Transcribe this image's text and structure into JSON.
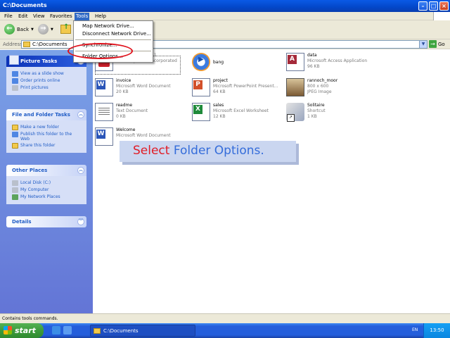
{
  "window": {
    "title": "C:\\Documents"
  },
  "menubar": {
    "items": [
      "File",
      "Edit",
      "View",
      "Favorites",
      "Tools",
      "Help"
    ],
    "active": "Tools"
  },
  "toolbar": {
    "back_label": "Back"
  },
  "address": {
    "label": "Address",
    "value": "C:\\Documents",
    "go_label": "Go"
  },
  "tools_menu": {
    "items": [
      "Map Network Drive...",
      "Disconnect Network Drive...",
      "Synchronize...",
      "Folder Options..."
    ]
  },
  "left_pane": {
    "picture_tasks": {
      "title": "Picture Tasks",
      "items": [
        "View as a slide show",
        "Order prints online",
        "Print pictures"
      ]
    },
    "file_folder_tasks": {
      "title": "File and Folder Tasks",
      "items": [
        "Make a new folder",
        "Publish this folder to the Web",
        "Share this folder"
      ]
    },
    "other_places": {
      "title": "Other Places",
      "items": [
        "Local Disk (C:)",
        "My Computer",
        "My Network Places"
      ]
    },
    "details": {
      "title": "Details"
    }
  },
  "files": [
    {
      "name": "",
      "type": "Acrobat Reader 3.1",
      "info": "Adobe Systems Incorporated",
      "icon": "pdf-icon"
    },
    {
      "name": "bang",
      "type": "",
      "info": "",
      "icon": "media-icon"
    },
    {
      "name": "data",
      "type": "Microsoft Access Application",
      "info": "96 KB",
      "icon": "access-icon"
    },
    {
      "name": "invoice",
      "type": "Microsoft Word Document",
      "info": "20 KB",
      "icon": "word-icon"
    },
    {
      "name": "project",
      "type": "Microsoft PowerPoint Present...",
      "info": "64 KB",
      "icon": "powerpoint-icon"
    },
    {
      "name": "rannoch_moor",
      "type": "800 x 600",
      "info": "JPEG Image",
      "icon": "image-icon"
    },
    {
      "name": "readme",
      "type": "Text Document",
      "info": "0 KB",
      "icon": "text-icon"
    },
    {
      "name": "sales",
      "type": "Microsoft Excel Worksheet",
      "info": "12 KB",
      "icon": "excel-icon"
    },
    {
      "name": "Solitaire",
      "type": "Shortcut",
      "info": "1 KB",
      "icon": "shortcut-icon"
    },
    {
      "name": "Welcome",
      "type": "Microsoft Word Document",
      "info": "",
      "icon": "word-icon"
    }
  ],
  "instruction": {
    "prefix": "Select",
    "rest": " Folder Options."
  },
  "status": {
    "text": "Contains tools commands."
  },
  "taskbar": {
    "start_label": "start",
    "task_label": "C:\\Documents",
    "lang": "EN",
    "clock": "13:50"
  }
}
